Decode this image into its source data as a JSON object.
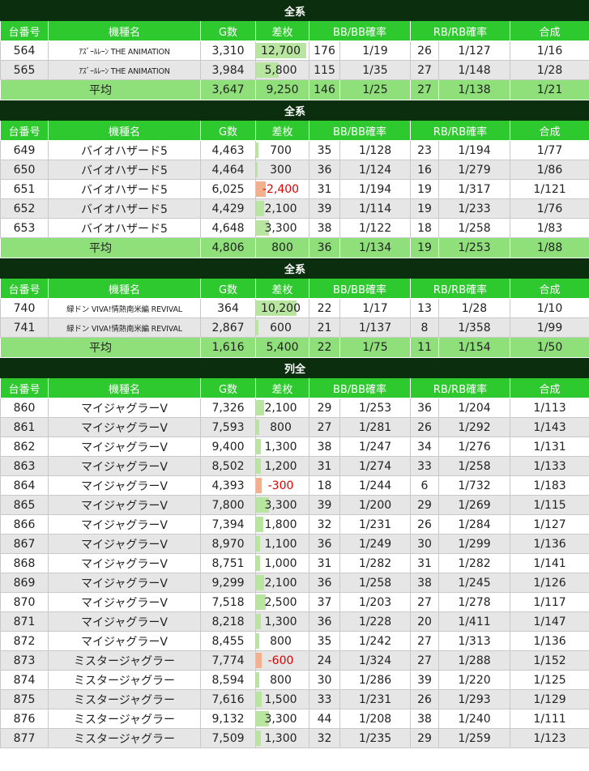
{
  "colors": {
    "section_bg": "#0b2e0e",
    "header_bg": "#2ec92e",
    "average_bg": "#8fe07a",
    "row_alt_bg": "#e6e6e6",
    "positive_bar": "#b8e6a0",
    "negative_bar": "#f2b08c",
    "negative_text": "#e00000"
  },
  "headers": [
    "台番号",
    "機種名",
    "G数",
    "差枚",
    "BB/BB確率",
    "RB/RB確率",
    "合成"
  ],
  "bar_scale_max": 12700,
  "groups": [
    {
      "title": "全系",
      "rows": [
        {
          "no": "564",
          "name": "ｱｽﾞｰﾙﾚｰﾝ THE ANIMATION",
          "g": "3,310",
          "diff": "12,700",
          "diff_num": 12700,
          "bb": "176",
          "bb_rate": "1/19",
          "rb": "26",
          "rb_rate": "1/127",
          "total": "1/16"
        },
        {
          "no": "565",
          "name": "ｱｽﾞｰﾙﾚｰﾝ THE ANIMATION",
          "g": "3,984",
          "diff": "5,800",
          "diff_num": 5800,
          "bb": "115",
          "bb_rate": "1/35",
          "rb": "27",
          "rb_rate": "1/148",
          "total": "1/28"
        }
      ],
      "average": {
        "label": "平均",
        "g": "3,647",
        "diff": "9,250",
        "bb": "146",
        "bb_rate": "1/25",
        "rb": "27",
        "rb_rate": "1/138",
        "total": "1/21"
      }
    },
    {
      "title": "全系",
      "rows": [
        {
          "no": "649",
          "name": "バイオハザード5",
          "g": "4,463",
          "diff": "700",
          "diff_num": 700,
          "bb": "35",
          "bb_rate": "1/128",
          "rb": "23",
          "rb_rate": "1/194",
          "total": "1/77"
        },
        {
          "no": "650",
          "name": "バイオハザード5",
          "g": "4,464",
          "diff": "300",
          "diff_num": 300,
          "bb": "36",
          "bb_rate": "1/124",
          "rb": "16",
          "rb_rate": "1/279",
          "total": "1/86"
        },
        {
          "no": "651",
          "name": "バイオハザード5",
          "g": "6,025",
          "diff": "-2,400",
          "diff_num": -2400,
          "bb": "31",
          "bb_rate": "1/194",
          "rb": "19",
          "rb_rate": "1/317",
          "total": "1/121"
        },
        {
          "no": "652",
          "name": "バイオハザード5",
          "g": "4,429",
          "diff": "2,100",
          "diff_num": 2100,
          "bb": "39",
          "bb_rate": "1/114",
          "rb": "19",
          "rb_rate": "1/233",
          "total": "1/76"
        },
        {
          "no": "653",
          "name": "バイオハザード5",
          "g": "4,648",
          "diff": "3,300",
          "diff_num": 3300,
          "bb": "38",
          "bb_rate": "1/122",
          "rb": "18",
          "rb_rate": "1/258",
          "total": "1/83"
        }
      ],
      "average": {
        "label": "平均",
        "g": "4,806",
        "diff": "800",
        "bb": "36",
        "bb_rate": "1/134",
        "rb": "19",
        "rb_rate": "1/253",
        "total": "1/88"
      }
    },
    {
      "title": "全系",
      "rows": [
        {
          "no": "740",
          "name": "緑ドン VIVA!情熱南米編 REVIVAL",
          "g": "364",
          "diff": "10,200",
          "diff_num": 10200,
          "bb": "22",
          "bb_rate": "1/17",
          "rb": "13",
          "rb_rate": "1/28",
          "total": "1/10"
        },
        {
          "no": "741",
          "name": "緑ドン VIVA!情熱南米編 REVIVAL",
          "g": "2,867",
          "diff": "600",
          "diff_num": 600,
          "bb": "21",
          "bb_rate": "1/137",
          "rb": "8",
          "rb_rate": "1/358",
          "total": "1/99"
        }
      ],
      "average": {
        "label": "平均",
        "g": "1,616",
        "diff": "5,400",
        "bb": "22",
        "bb_rate": "1/75",
        "rb": "11",
        "rb_rate": "1/154",
        "total": "1/50"
      }
    },
    {
      "title": "列全",
      "rows": [
        {
          "no": "860",
          "name": "マイジャグラーV",
          "g": "7,326",
          "diff": "2,100",
          "diff_num": 2100,
          "bb": "29",
          "bb_rate": "1/253",
          "rb": "36",
          "rb_rate": "1/204",
          "total": "1/113"
        },
        {
          "no": "861",
          "name": "マイジャグラーV",
          "g": "7,593",
          "diff": "800",
          "diff_num": 800,
          "bb": "27",
          "bb_rate": "1/281",
          "rb": "26",
          "rb_rate": "1/292",
          "total": "1/143"
        },
        {
          "no": "862",
          "name": "マイジャグラーV",
          "g": "9,400",
          "diff": "1,300",
          "diff_num": 1300,
          "bb": "38",
          "bb_rate": "1/247",
          "rb": "34",
          "rb_rate": "1/276",
          "total": "1/131"
        },
        {
          "no": "863",
          "name": "マイジャグラーV",
          "g": "8,502",
          "diff": "1,200",
          "diff_num": 1200,
          "bb": "31",
          "bb_rate": "1/274",
          "rb": "33",
          "rb_rate": "1/258",
          "total": "1/133"
        },
        {
          "no": "864",
          "name": "マイジャグラーV",
          "g": "4,393",
          "diff": "-300",
          "diff_num": -300,
          "bb": "18",
          "bb_rate": "1/244",
          "rb": "6",
          "rb_rate": "1/732",
          "total": "1/183"
        },
        {
          "no": "865",
          "name": "マイジャグラーV",
          "g": "7,800",
          "diff": "3,300",
          "diff_num": 3300,
          "bb": "39",
          "bb_rate": "1/200",
          "rb": "29",
          "rb_rate": "1/269",
          "total": "1/115"
        },
        {
          "no": "866",
          "name": "マイジャグラーV",
          "g": "7,394",
          "diff": "1,800",
          "diff_num": 1800,
          "bb": "32",
          "bb_rate": "1/231",
          "rb": "26",
          "rb_rate": "1/284",
          "total": "1/127"
        },
        {
          "no": "867",
          "name": "マイジャグラーV",
          "g": "8,970",
          "diff": "1,100",
          "diff_num": 1100,
          "bb": "36",
          "bb_rate": "1/249",
          "rb": "30",
          "rb_rate": "1/299",
          "total": "1/136"
        },
        {
          "no": "868",
          "name": "マイジャグラーV",
          "g": "8,751",
          "diff": "1,000",
          "diff_num": 1000,
          "bb": "31",
          "bb_rate": "1/282",
          "rb": "31",
          "rb_rate": "1/282",
          "total": "1/141"
        },
        {
          "no": "869",
          "name": "マイジャグラーV",
          "g": "9,299",
          "diff": "2,100",
          "diff_num": 2100,
          "bb": "36",
          "bb_rate": "1/258",
          "rb": "38",
          "rb_rate": "1/245",
          "total": "1/126"
        },
        {
          "no": "870",
          "name": "マイジャグラーV",
          "g": "7,518",
          "diff": "2,500",
          "diff_num": 2500,
          "bb": "37",
          "bb_rate": "1/203",
          "rb": "27",
          "rb_rate": "1/278",
          "total": "1/117"
        },
        {
          "no": "871",
          "name": "マイジャグラーV",
          "g": "8,218",
          "diff": "1,300",
          "diff_num": 1300,
          "bb": "36",
          "bb_rate": "1/228",
          "rb": "20",
          "rb_rate": "1/411",
          "total": "1/147"
        },
        {
          "no": "872",
          "name": "マイジャグラーV",
          "g": "8,455",
          "diff": "800",
          "diff_num": 800,
          "bb": "35",
          "bb_rate": "1/242",
          "rb": "27",
          "rb_rate": "1/313",
          "total": "1/136"
        },
        {
          "no": "873",
          "name": "ミスタージャグラー",
          "g": "7,774",
          "diff": "-600",
          "diff_num": -600,
          "bb": "24",
          "bb_rate": "1/324",
          "rb": "27",
          "rb_rate": "1/288",
          "total": "1/152"
        },
        {
          "no": "874",
          "name": "ミスタージャグラー",
          "g": "8,594",
          "diff": "800",
          "diff_num": 800,
          "bb": "30",
          "bb_rate": "1/286",
          "rb": "39",
          "rb_rate": "1/220",
          "total": "1/125"
        },
        {
          "no": "875",
          "name": "ミスタージャグラー",
          "g": "7,616",
          "diff": "1,500",
          "diff_num": 1500,
          "bb": "33",
          "bb_rate": "1/231",
          "rb": "26",
          "rb_rate": "1/293",
          "total": "1/129"
        },
        {
          "no": "876",
          "name": "ミスタージャグラー",
          "g": "9,132",
          "diff": "3,300",
          "diff_num": 3300,
          "bb": "44",
          "bb_rate": "1/208",
          "rb": "38",
          "rb_rate": "1/240",
          "total": "1/111"
        },
        {
          "no": "877",
          "name": "ミスタージャグラー",
          "g": "7,509",
          "diff": "1,300",
          "diff_num": 1300,
          "bb": "32",
          "bb_rate": "1/235",
          "rb": "29",
          "rb_rate": "1/259",
          "total": "1/123"
        }
      ]
    }
  ]
}
